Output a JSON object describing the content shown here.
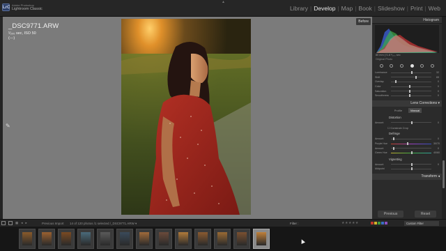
{
  "app": {
    "brand_line1": "Adobe Photoshop",
    "brand_line2": "Lightroom Classic",
    "logo_text": "LrC"
  },
  "modules": [
    "Library",
    "Develop",
    "Map",
    "Book",
    "Slideshow",
    "Print",
    "Web"
  ],
  "active_module": "Develop",
  "photo_info": {
    "filename": "_DSC9771.ARW",
    "exposure": "¹⁄₂₀₀ sec, ISO 50",
    "lens": "(---)"
  },
  "before_label": "Before",
  "right_panel": {
    "histogram_title": "Histogram",
    "histogram_info": "80 mm   ƒ/1.8   ¹⁄₂₀₀ sec",
    "original_photo": "Original Photo",
    "hsl_sliders": [
      {
        "label": "Luminance",
        "value": "32"
      },
      {
        "label": "Shift",
        "value": "65"
      },
      {
        "label": "Overlap",
        "value": "0"
      },
      {
        "label": "Color",
        "value": "0"
      },
      {
        "label": "Saturation",
        "value": "0"
      },
      {
        "label": "Smoothness",
        "value": "0"
      }
    ],
    "lens_corrections_title": "Lens Corrections",
    "profile_tab": "Profile",
    "manual_tab": "Manual",
    "distortion_label": "Distortion",
    "distortion_amount": "Amount",
    "constrain_crop": "Constrain Crop",
    "defringe_label": "Defringe",
    "defringe_sliders": [
      {
        "label": "Amount",
        "value": "0"
      },
      {
        "label": "Purple Hue",
        "value": "30/70"
      },
      {
        "label": "Amount",
        "value": "0"
      },
      {
        "label": "Green Hue",
        "value": "40/60"
      }
    ],
    "vignetting_label": "Vignetting",
    "vignetting_sliders": [
      {
        "label": "Amount",
        "value": "0"
      },
      {
        "label": "Midpoint",
        "value": ""
      }
    ],
    "transform_title": "Transform",
    "previous_button": "Previous",
    "reset_button": "Reset"
  },
  "filmstrip_bar": {
    "source": "Previous Import",
    "count": "14 of 120 photos /1 selected /_DSC9771.ARW ▾",
    "filter_label": "Filter :",
    "stars": "★★★★★",
    "custom_filter": "Custom Filter"
  },
  "colors": {
    "accent": "#e8e8e8",
    "label_red": "#c0392b",
    "label_yellow": "#d4b32a",
    "label_green": "#3c9a3c",
    "label_blue": "#3a6fc2",
    "label_purple": "#8a4fbf"
  },
  "filmstrip_count": 13,
  "selected_thumb_index": 12
}
